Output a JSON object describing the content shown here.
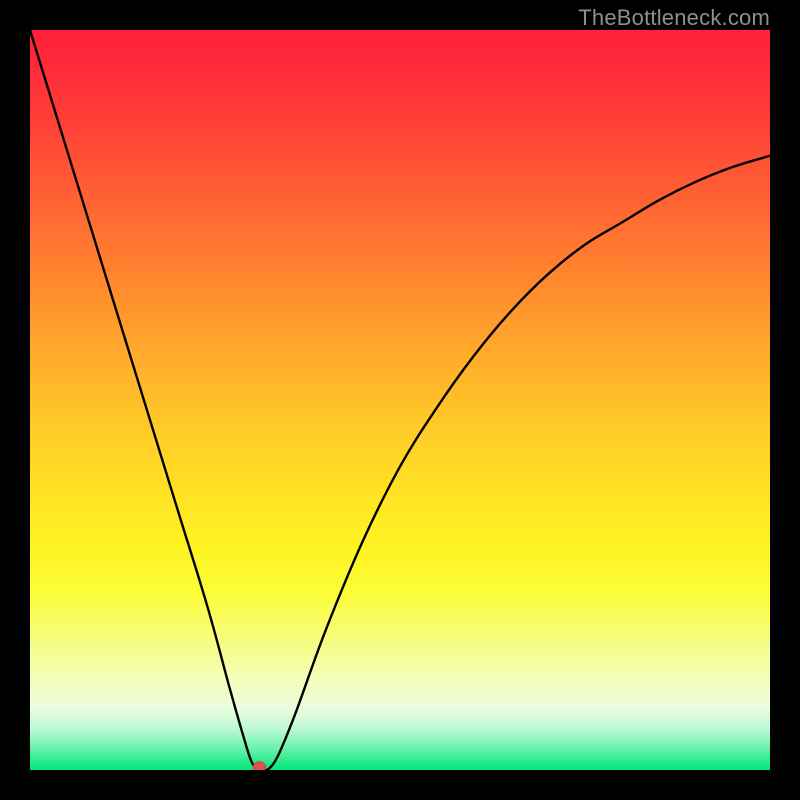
{
  "watermark": "TheBottleneck.com",
  "colors": {
    "frame": "#000000",
    "curve": "#000000",
    "marker": "#d9534f"
  },
  "chart_data": {
    "type": "line",
    "title": "",
    "xlabel": "",
    "ylabel": "",
    "xlim": [
      0,
      100
    ],
    "ylim": [
      0,
      100
    ],
    "grid": false,
    "legend": false,
    "note": "V-shaped bottleneck mismatch curve over red-to-green heat gradient; minimum (optimal match) near x≈31.",
    "series": [
      {
        "name": "bottleneck-curve",
        "x": [
          0,
          4,
          8,
          12,
          16,
          20,
          24,
          27,
          29,
          30,
          31,
          32,
          33,
          34,
          36,
          40,
          45,
          50,
          55,
          60,
          65,
          70,
          75,
          80,
          85,
          90,
          95,
          100
        ],
        "y": [
          100,
          87,
          74,
          61,
          48,
          35,
          22,
          11,
          4,
          1,
          0,
          0,
          1,
          3,
          8,
          19,
          31,
          41,
          49,
          56,
          62,
          67,
          71,
          74,
          77,
          79.5,
          81.5,
          83
        ]
      }
    ],
    "marker": {
      "x": 31,
      "y": 0
    },
    "gradient_stops": [
      {
        "pct": 0,
        "color": "#ff1f3a"
      },
      {
        "pct": 50,
        "color": "#ffcb27"
      },
      {
        "pct": 90,
        "color": "#f4fdb2"
      },
      {
        "pct": 100,
        "color": "#00e67b"
      }
    ]
  }
}
